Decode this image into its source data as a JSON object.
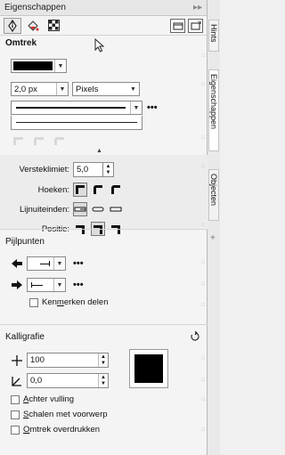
{
  "panel": {
    "title": "Eigenschappen",
    "collapse_glyph": "▸▸"
  },
  "outline": {
    "section_title": "Omtrek",
    "width_value": "2,0 px",
    "unit_value": "Pixels",
    "corner_limit_label": "Versteklimiet:",
    "corner_limit_value": "5,0",
    "corners_label": "Hoeken:",
    "line_caps_label": "Lijnuiteinden:",
    "position_label": "Positie:"
  },
  "arrowheads": {
    "section_title": "Pijlpunten",
    "share_attrs_label_pre": "Ken",
    "share_attrs_label_ul": "m",
    "share_attrs_label_post": "erken delen"
  },
  "calligraphy": {
    "section_title": "Kalligrafie",
    "stretch_value": "100",
    "angle_value": "0,0",
    "behind_fill_ul": "A",
    "behind_fill_rest": "chter vulling",
    "scale_ul": "S",
    "scale_rest": "chalen met voorwerp",
    "overprint_ul": "O",
    "overprint_rest": "mtrek overdrukken"
  },
  "side_tabs": {
    "hints": "Hints",
    "properties": "Eigenschappen",
    "objects": "Objecten"
  },
  "colors": {
    "outline_color": "#000000",
    "calligraphy_swatch": "#000000"
  }
}
